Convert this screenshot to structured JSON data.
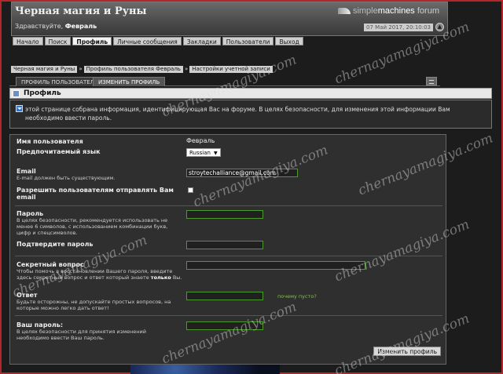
{
  "header": {
    "site_title": "Черная магия и Руны",
    "logo": {
      "part1": "simple",
      "part2": "machines",
      "part3": " forum"
    },
    "greeting_prefix": "Здравствуйте, ",
    "username": "Февраль",
    "datetime": "07 Май 2017, 20:10:03",
    "collapse_icon": "▲"
  },
  "menu": {
    "items": [
      {
        "label": "Начало"
      },
      {
        "label": "Поиск"
      },
      {
        "label": "Профиль"
      },
      {
        "label": "Личные сообщения"
      },
      {
        "label": "Закладки"
      },
      {
        "label": "Пользователи"
      },
      {
        "label": "Выход"
      }
    ]
  },
  "breadcrumb": {
    "items": [
      {
        "label": "Черная магия и Руны"
      },
      {
        "label": "Профиль пользователя Февраль"
      },
      {
        "label": "Настройки учетной записи"
      }
    ],
    "separator": "»"
  },
  "tabs": {
    "items": [
      {
        "label": "ПРОФИЛЬ ПОЛЬЗОВАТЕЛЯ"
      },
      {
        "label": "ИЗМЕНИТЬ ПРОФИЛЬ"
      }
    ]
  },
  "category": {
    "title": "Профиль"
  },
  "info": {
    "text": "этой странице собрана информация, идентифицирующая Вас на форуме. В целях безопасности, для изменения этой информации Вам необходимо ввести пароль."
  },
  "form": {
    "username_label": "Имя пользователя",
    "username_value": "Февраль",
    "language_label": "Предпочитаемый язык",
    "language_value": "Russian",
    "language_arrow": "▼",
    "email_label": "Email",
    "email_hint": "E-mail должен быть существующим.",
    "email_value": "stroytechalliance@gmail.com",
    "allow_email_label": "Разрешить пользователям отправлять Вам email",
    "password_label": "Пароль",
    "password_hint": "В целях безопасности, рекомендуется использовать не менее 6 символов, с использованием комбинации букв, цифр и спецсимволов.",
    "confirm_password_label": "Подтвердите пароль",
    "secret_question_label": "Секретный вопрос",
    "secret_question_hint_1": "Чтобы помочь в восстановлении Вашего пароля, введите здесь секретный вопрос и ответ который знаете ",
    "secret_question_hint_bold": "только",
    "secret_question_hint_2": " Вы.",
    "answer_label": "Ответ",
    "answer_hint": "Будьте осторожны, не допускайте простых вопросов, на которые можно легко дать ответ!",
    "empty_help_link": "почему пусто?",
    "current_password_label": "Ваш пароль:",
    "current_password_hint": "В целях безопасности для принятия изменений необходимо ввести Ваш пароль.",
    "submit_label": "Изменить профиль"
  },
  "watermark": {
    "text": "chernayamagiya.com"
  },
  "colors": {
    "accent_border": "#b3262a",
    "input_border": "#4c9a2a",
    "link": "#7fc34a"
  }
}
